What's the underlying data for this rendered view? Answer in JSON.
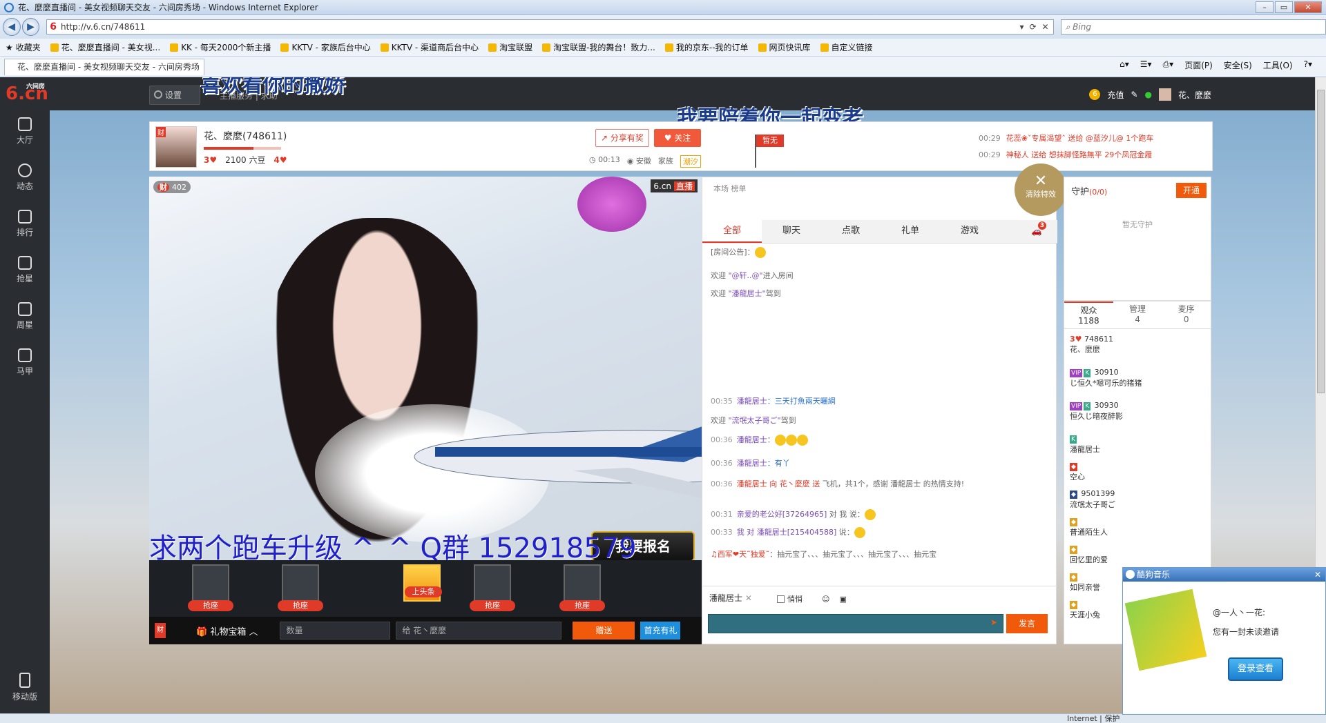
{
  "browser": {
    "title": "花、麼麼直播间 - 美女视频聊天交友 - 六间房秀场 - Windows Internet Explorer",
    "url": "http://v.6.cn/748611",
    "search_placeholder": "Bing",
    "favorites_label": "收藏夹",
    "favorites": [
      "花、麼麼直播间 - 美女视...",
      "KK - 每天2000个新主播",
      "KKTV - 家族后台中心",
      "KKTV - 渠道商后台中心",
      "淘宝联盟",
      "淘宝联盟-我的舞台！致力...",
      "我的京东--我的订单",
      "网页快讯库",
      "自定义链接"
    ],
    "tab_title": "花、麼麼直播间 - 美女视频聊天交友 - 六间房秀场",
    "commands": {
      "page": "页面(P)",
      "safety": "安全(S)",
      "tools": "工具(O)"
    },
    "status_zone": "Internet | 保护"
  },
  "site": {
    "logo": "6.cn",
    "logo_sub": "六间房",
    "settings": "设置",
    "service_links": "主播服务 | 求助",
    "recharge": "充值",
    "user": "花、麼麼"
  },
  "overlay": {
    "line1": "喜欢看你的撒娇",
    "line2": "我要陪着你一起变老"
  },
  "sidenav": [
    "大厅",
    "动态",
    "排行",
    "抢星",
    "周星",
    "马甲"
  ],
  "sidenav_mobile": "移动版",
  "anchor": {
    "name": "花、麼麼(748611)",
    "level_left": "3",
    "beans": "2100 六豆",
    "level_right": "4",
    "share": "分享有奖",
    "follow": "关注",
    "time": "00:13",
    "location": "安徽",
    "family_label": "家族",
    "family": "潮汐",
    "flag": "暂无",
    "gifts": [
      {
        "time": "00:29",
        "text": "花蕊❀ˇ专属渴望ˆ 送给 @蓝汐儿@ 1个跑车"
      },
      {
        "time": "00:29",
        "text": "神秘人 送给 想抹脚怪路無平 29个凤冠金履"
      }
    ]
  },
  "video": {
    "fans": "402",
    "fans_tag": "财",
    "watermark": "6.cn",
    "watermark_tag": "直播",
    "contest": "我要报名",
    "big_message": "求两个跑车升级 ^_^ Q群 152918579"
  },
  "seats": [
    {
      "label": "抢座"
    },
    {
      "label": "抢座"
    },
    {
      "label": "上头条"
    },
    {
      "label": "抢座"
    },
    {
      "label": "抢座"
    }
  ],
  "giftbar": {
    "tag": "财",
    "box": "礼物宝箱",
    "qty_placeholder": "数量",
    "to": "给 花丶麼麼",
    "send": "赠送",
    "charge": "首充有礼"
  },
  "chat": {
    "rank": "本场 榜单",
    "clear_fx": "清除特效",
    "tabs": [
      "全部",
      "聊天",
      "点歌",
      "礼单",
      "游戏"
    ],
    "car_count": "3",
    "messages": [
      {
        "time": "",
        "a": "[房间公告]：",
        "b": "",
        "c": ""
      },
      {
        "time": "",
        "a": "欢迎 ",
        "b": "\"@轩..@\"",
        "c": "进入房间"
      },
      {
        "time": "",
        "a": "欢迎 ",
        "b": "\"潘龍居士\"",
        "c": "驾到"
      },
      {
        "time": "00:35",
        "a": "",
        "b": "潘龍居士",
        "c": "：三天打魚兩天曬網"
      },
      {
        "time": "",
        "a": "欢迎 ",
        "b": "\"流氓太子哥ご\"",
        "c": "驾到"
      },
      {
        "time": "00:36",
        "a": "",
        "b": "潘龍居士",
        "c": "："
      },
      {
        "time": "00:36",
        "a": "",
        "b": "潘龍居士",
        "c": "：有丫"
      },
      {
        "time": "00:36",
        "a": "",
        "b": "潘龍居士 向 花丶麼麼 送",
        "c": " 飞机，共1个，感谢 潘龍居士 的热情支持!"
      },
      {
        "time": "00:31",
        "a": "",
        "b": "亲爱的老公好[37264965]",
        "c": " 对 我 说："
      },
      {
        "time": "00:33",
        "a": "",
        "b": "我 对 潘龍居士[215404588]",
        "c": " 说："
      },
      {
        "time": "",
        "a": "",
        "b": "♫西军❤天˜独爱˜",
        "c": "：抽元宝了、、、抽元宝了、、、抽元宝了、、、抽元宝"
      }
    ],
    "input_user": "潘龍居士",
    "whisper": "悄悄",
    "send": "发言"
  },
  "guard": {
    "title": "守护",
    "count": "(0/0)",
    "open": "开通",
    "empty": "暂无守护"
  },
  "audience": {
    "tabs": [
      {
        "label": "观众",
        "count": "1188"
      },
      {
        "label": "管理",
        "count": "4"
      },
      {
        "label": "麦序",
        "count": "0"
      }
    ],
    "list": [
      {
        "id": "748611",
        "name": "花、麼麼"
      },
      {
        "id": "30910",
        "name": "じ恒久*嗯可乐的猪猪"
      },
      {
        "id": "30930",
        "name": "恒久じ暗夜醉影"
      },
      {
        "id": "",
        "name": "潘龍居士"
      },
      {
        "id": "",
        "name": "空心"
      },
      {
        "id": "9501399",
        "name": "流氓太子哥ご"
      },
      {
        "id": "",
        "name": "普通陌生人"
      },
      {
        "id": "",
        "name": "回忆里的爱"
      },
      {
        "id": "",
        "name": "如同亲誉"
      },
      {
        "id": "",
        "name": "天涯小兔"
      }
    ]
  },
  "kugou": {
    "title": "酷狗音乐",
    "line1": "@一人丶一花:",
    "line2": "您有一封未读邀请",
    "button": "登录查看"
  }
}
